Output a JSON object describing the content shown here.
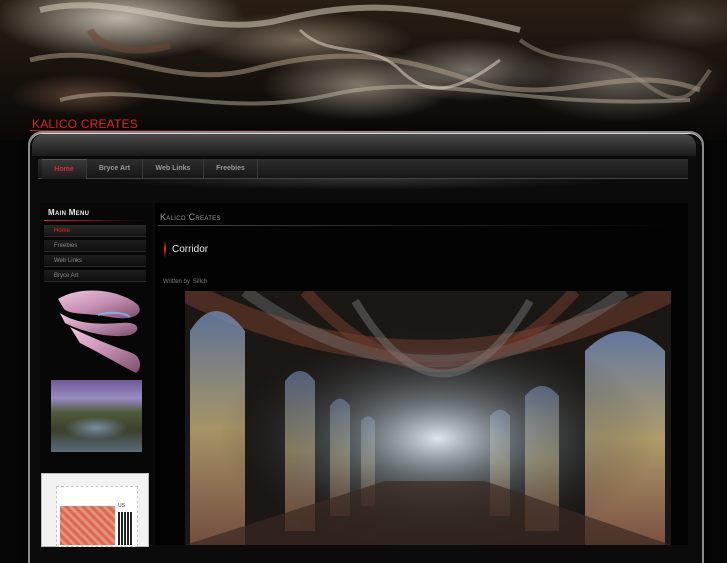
{
  "site": {
    "title": "KALICO CREATES",
    "accent_color": "#e3242b"
  },
  "nav": {
    "items": [
      {
        "label": "Home",
        "active": true
      },
      {
        "label": "Bryce Art",
        "active": false
      },
      {
        "label": "Web Links",
        "active": false
      },
      {
        "label": "Freebies",
        "active": false
      }
    ]
  },
  "sidebar": {
    "menu_title": "Main Menu",
    "items": [
      {
        "label": "Home",
        "active": true
      },
      {
        "label": "Freebies",
        "active": false
      },
      {
        "label": "Web Links",
        "active": false
      },
      {
        "label": "Bryce Art",
        "active": false
      }
    ],
    "stamp_label": "US"
  },
  "main": {
    "section_title": "Kalico Creates",
    "article": {
      "title": "Corridor",
      "byline_prefix": "Written by",
      "author": "Sillch"
    }
  }
}
